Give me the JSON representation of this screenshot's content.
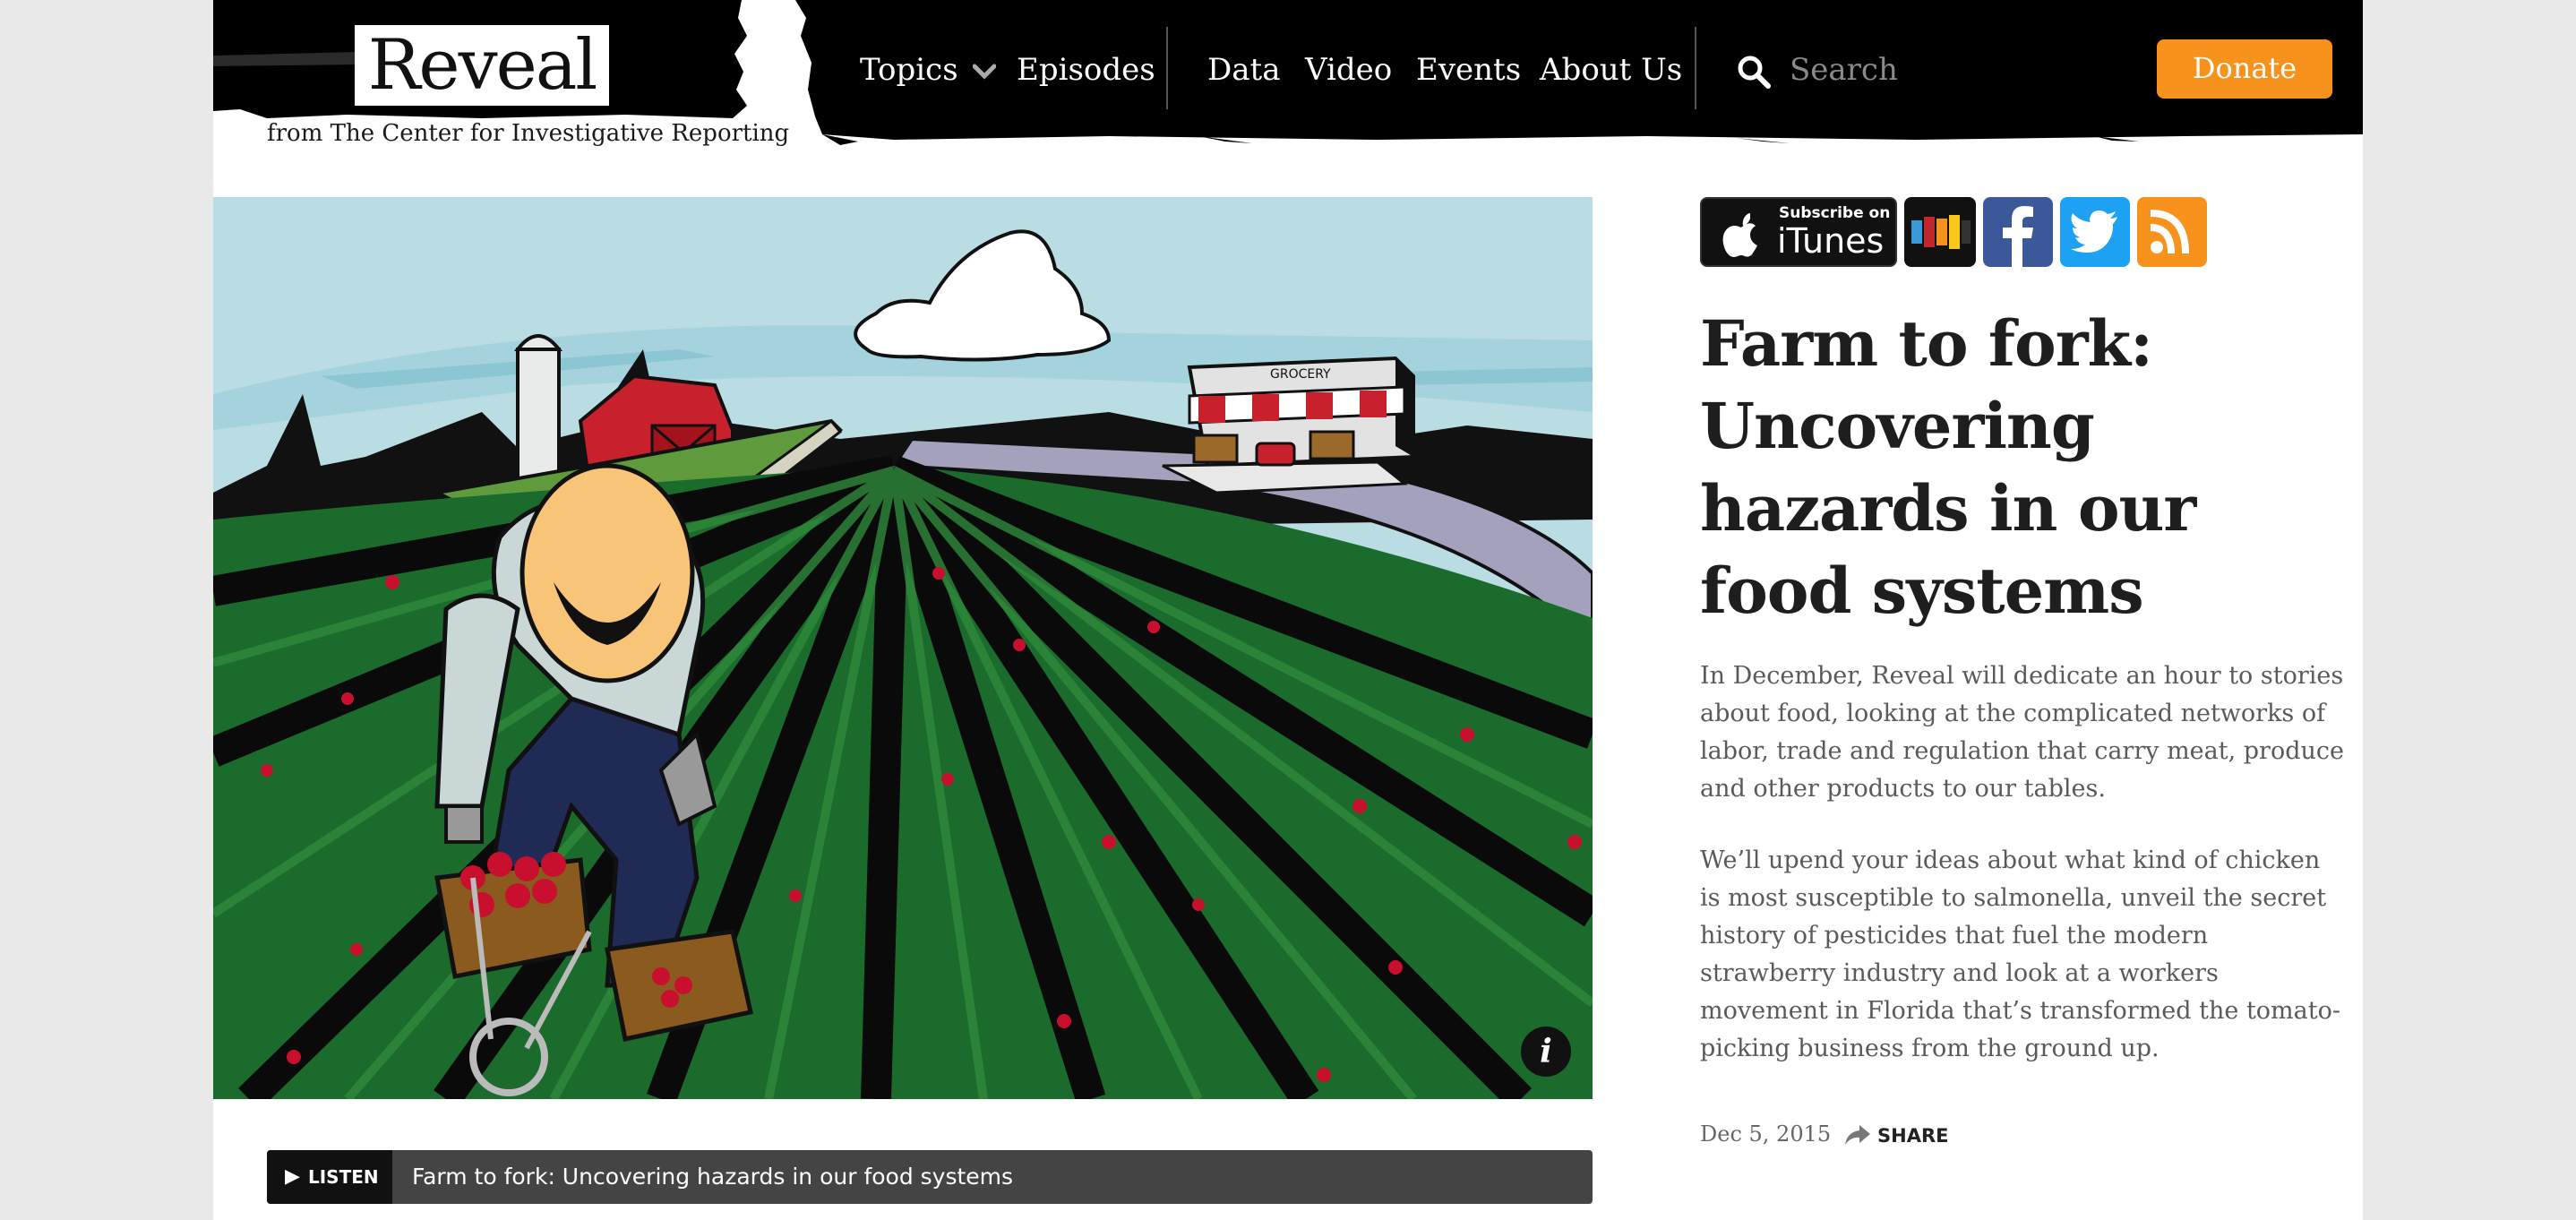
{
  "header": {
    "logo": "Reveal",
    "tagline": "from The Center for Investigative Reporting",
    "nav": {
      "topics": "Topics",
      "episodes": "Episodes",
      "data": "Data",
      "video": "Video",
      "events": "Events",
      "about": "About Us"
    },
    "search_placeholder": "Search",
    "donate": "Donate"
  },
  "hero": {
    "store_sign": "GROCERY",
    "info_label": "i"
  },
  "listen_bar": {
    "button_label": "LISTEN",
    "play_glyph": "▶",
    "title": "Farm to fork: Uncovering hazards in our food systems"
  },
  "sidebar": {
    "subscribe": {
      "itunes_small": "Subscribe on",
      "itunes_big": "iTunes",
      "icons": [
        "apple-icon",
        "stitcher-icon",
        "facebook-icon",
        "twitter-icon",
        "rss-icon"
      ]
    },
    "title": "Farm to fork: Uncovering hazards in our food systems",
    "paragraphs": [
      "In December, Reveal will dedicate an hour to stories about food, looking at the complicated networks of labor, trade and regulation that carry meat, produce and other products to our tables.",
      "We’ll upend your ideas about what kind of chicken is most susceptible to salmonella, unveil the secret history of pesticides that fuel the modern strawberry industry and look at a workers movement in Florida that’s transformed the tomato-picking business from the ground up."
    ],
    "date": "Dec 5, 2015",
    "share": "SHARE"
  },
  "colors": {
    "header_bg": "#000000",
    "accent_orange": "#f7931d",
    "facebook_blue": "#3b5998",
    "twitter_blue": "#1da1f2",
    "listen_bar_bg": "#444444",
    "field_green": "#1b6b2c",
    "sky": "#b9dde3"
  }
}
